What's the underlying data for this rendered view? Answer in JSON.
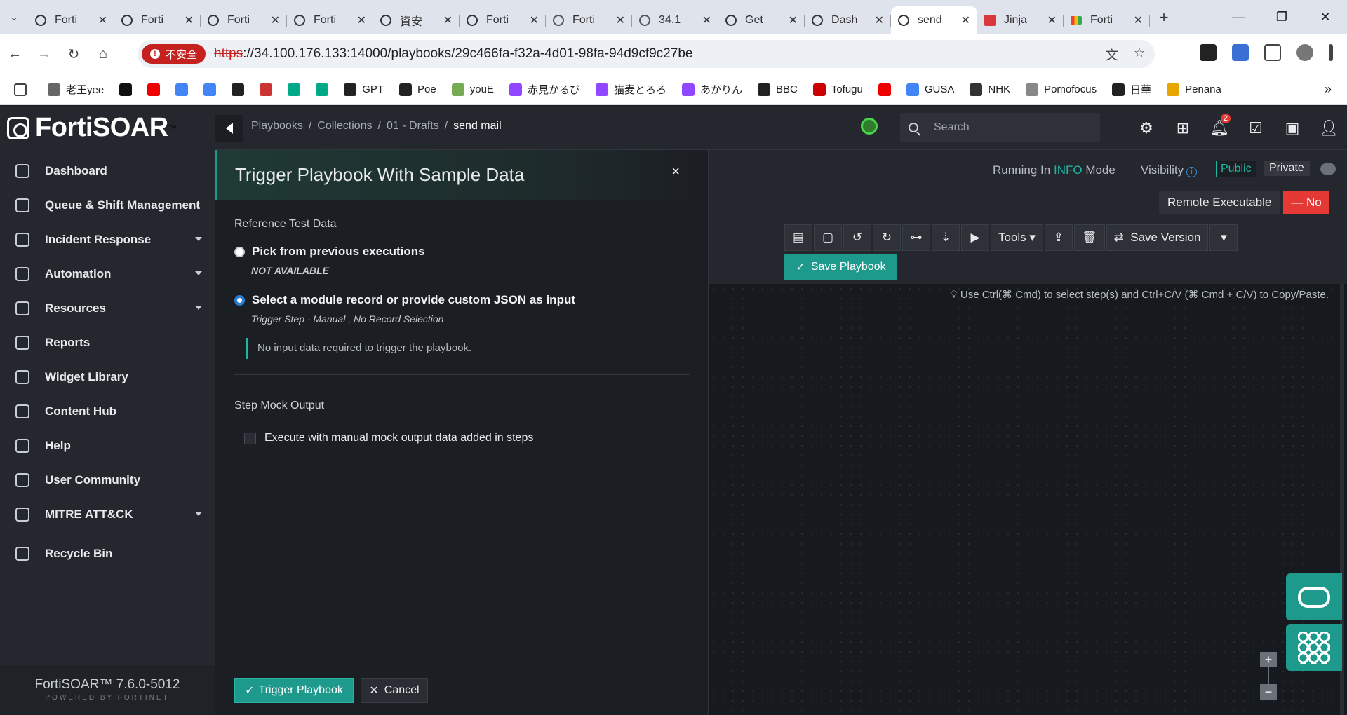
{
  "browser": {
    "tabs": [
      {
        "title": "Forti",
        "icon": "openai-icon"
      },
      {
        "title": "Forti",
        "icon": "openai-icon"
      },
      {
        "title": "Forti",
        "icon": "openai-icon"
      },
      {
        "title": "Forti",
        "icon": "openai-icon"
      },
      {
        "title": "資安",
        "icon": "openai-icon"
      },
      {
        "title": "Forti",
        "icon": "openai-icon"
      },
      {
        "title": "Forti",
        "icon": "globe-icon"
      },
      {
        "title": "34.1",
        "icon": "globe-icon"
      },
      {
        "title": "Get",
        "icon": "openai-icon"
      },
      {
        "title": "Dash",
        "icon": "openai-icon"
      },
      {
        "title": "send",
        "icon": "openai-icon",
        "active": true
      },
      {
        "title": "Jinja",
        "icon": "jinja-icon"
      },
      {
        "title": "Forti",
        "icon": "gmail-icon"
      }
    ],
    "insecure_label": "不安全",
    "url_scheme": "https",
    "url_rest": "://34.100.176.133:14000/playbooks/29c466fa-f32a-4d01-98fa-94d9cf9c27be",
    "bookmarks": [
      "老王yee",
      "",
      "",
      "",
      "",
      "",
      "",
      "",
      "",
      "GPT",
      "Poe",
      "youE",
      "赤見かるび",
      "猫麦とろろ",
      "あかりん",
      "BBC",
      "Tofugu",
      "",
      "GUSA",
      "NHK",
      "Pomofocus",
      "日華",
      "Penana"
    ]
  },
  "app": {
    "logo": "FortiSOAR",
    "breadcrumbs": [
      "Playbooks",
      "/",
      "Collections",
      "/",
      "01 - Drafts",
      "/"
    ],
    "current_page": "send mail",
    "search_placeholder": "Search",
    "notification_count": "2",
    "version": "FortiSOAR™  7.6.0-5012",
    "powered": "POWERED BY FORTINET"
  },
  "sidebar": {
    "items": [
      {
        "label": "Dashboard",
        "expand": false
      },
      {
        "label": "Queue & Shift Management",
        "expand": false
      },
      {
        "label": "Incident Response",
        "expand": true
      },
      {
        "label": "Automation",
        "expand": true
      },
      {
        "label": "Resources",
        "expand": true
      },
      {
        "label": "Reports",
        "expand": false
      },
      {
        "label": "Widget Library",
        "expand": false
      },
      {
        "label": "Content Hub",
        "expand": false
      },
      {
        "label": "Help",
        "expand": false
      },
      {
        "label": "User Community",
        "expand": false
      },
      {
        "label": "MITRE ATT&CK",
        "expand": true
      },
      {
        "label": "Recycle Bin",
        "expand": false
      }
    ]
  },
  "dialog": {
    "title": "Trigger Playbook With Sample Data",
    "close": "×",
    "ref_label": "Reference Test Data",
    "option1": "Pick from previous executions",
    "option1_sub": "NOT AVAILABLE",
    "option2": "Select a module record or provide custom JSON as input",
    "option2_sub": "Trigger Step - Manual  , No Record Selection",
    "note": "No input data required to trigger the playbook.",
    "mock_label": "Step Mock Output",
    "mock_check": "Execute with manual mock output data added in steps",
    "trigger_btn": "Trigger Playbook",
    "cancel_btn": "Cancel",
    "selected_option": 2
  },
  "editor": {
    "running_pre": "Running In",
    "running_mode": "INFO",
    "running_post": "Mode",
    "visibility": "Visibility",
    "public": "Public",
    "private": "Private",
    "remote_label": "Remote Executable",
    "remote_value": "— No",
    "tools": "Tools",
    "save_version": "Save Version",
    "save_playbook": "Save Playbook",
    "hint": "Use Ctrl(⌘ Cmd) to select step(s) and Ctrl+C/V (⌘ Cmd + C/V) to Copy/Paste."
  },
  "colors": {
    "accent": "#1d9a8c",
    "danger": "#e53935",
    "info": "#1fb6a4"
  }
}
